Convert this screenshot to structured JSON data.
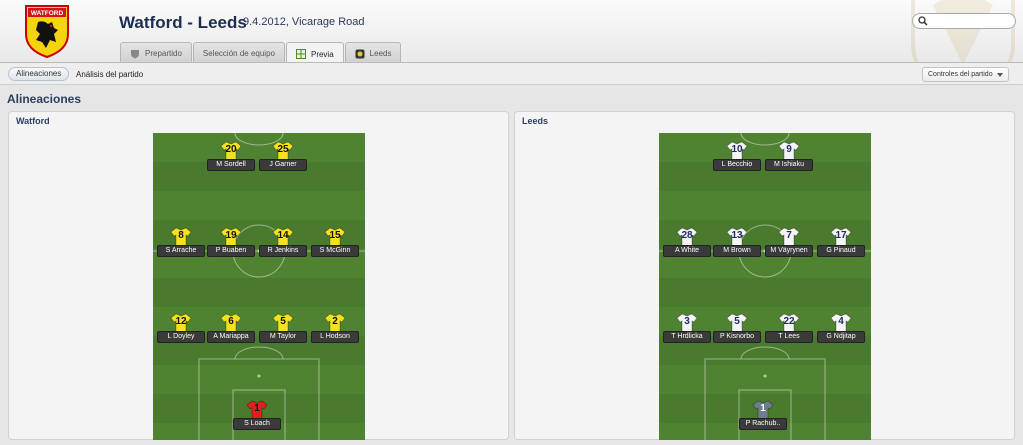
{
  "header": {
    "title": "Watford - Leeds",
    "subtitle": "9.4.2012, Vicarage Road",
    "crest_text": "WATFORD",
    "search_placeholder": ""
  },
  "tabs": [
    {
      "label": "Prepartido",
      "icon": "shield-icon",
      "active": false
    },
    {
      "label": "Selección de equipo",
      "icon": "",
      "active": false
    },
    {
      "label": "Previa",
      "icon": "preview-icon",
      "active": true
    },
    {
      "label": "Leeds",
      "icon": "team-icon",
      "active": false
    }
  ],
  "subnav": {
    "active": "Alineaciones",
    "link": "Análisis del partido",
    "controls": "Controles del partido"
  },
  "section_title": "Alineaciones",
  "colors": {
    "watford_shirt": "#f5e11d",
    "watford_gk": "#e0201c",
    "leeds_shirt": "#f4f4f4",
    "leeds_gk": "#6e7d8d",
    "title": "#1c2e52"
  },
  "teams": {
    "home": {
      "name": "Watford",
      "players": [
        {
          "num": "20",
          "name": "M Sordell"
        },
        {
          "num": "25",
          "name": "J Garner"
        },
        {
          "num": "8",
          "name": "S Arrache"
        },
        {
          "num": "19",
          "name": "P Buaben"
        },
        {
          "num": "14",
          "name": "R Jenkins"
        },
        {
          "num": "15",
          "name": "S McGinn"
        },
        {
          "num": "12",
          "name": "L Doyley"
        },
        {
          "num": "6",
          "name": "A Mariappa"
        },
        {
          "num": "5",
          "name": "M Taylor"
        },
        {
          "num": "2",
          "name": "L Hodson"
        },
        {
          "num": "1",
          "name": "S Loach"
        }
      ]
    },
    "away": {
      "name": "Leeds",
      "players": [
        {
          "num": "10",
          "name": "L Becchio"
        },
        {
          "num": "9",
          "name": "M Ishiaku"
        },
        {
          "num": "28",
          "name": "A White"
        },
        {
          "num": "13",
          "name": "M Brown"
        },
        {
          "num": "7",
          "name": "M Väyrynen"
        },
        {
          "num": "17",
          "name": "G Pinaud"
        },
        {
          "num": "3",
          "name": "T Hrdlicka"
        },
        {
          "num": "5",
          "name": "P Kisnorbo"
        },
        {
          "num": "22",
          "name": "T Lees"
        },
        {
          "num": "4",
          "name": "G Ndjitap"
        },
        {
          "num": "1",
          "name": "P Rachub.."
        }
      ]
    }
  }
}
